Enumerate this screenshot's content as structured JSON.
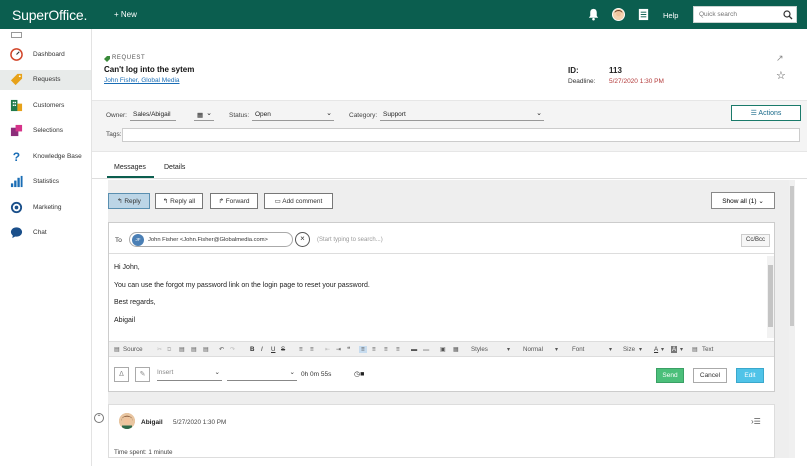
{
  "topbar": {
    "brand": "SuperOffice.",
    "new_label": "+ New",
    "help_label": "Help",
    "search_placeholder": "Quick search",
    "bg_color": "#0b5e4f"
  },
  "sidebar": {
    "items": [
      {
        "label": "Dashboard",
        "icon": "dashboard-gauge-icon"
      },
      {
        "label": "Requests",
        "icon": "requests-tag-icon"
      },
      {
        "label": "Customers",
        "icon": "customers-building-icon"
      },
      {
        "label": "Selections",
        "icon": "selections-icon"
      },
      {
        "label": "Knowledge Base",
        "icon": "question-mark-icon"
      },
      {
        "label": "Statistics",
        "icon": "bar-chart-icon"
      },
      {
        "label": "Marketing",
        "icon": "target-icon"
      },
      {
        "label": "Chat",
        "icon": "chat-bubble-icon"
      }
    ]
  },
  "request": {
    "type_label": "REQUEST",
    "title": "Can't log into the sytem",
    "contact": "John Fisher, Global Media",
    "id_label": "ID:",
    "id_value": "113",
    "deadline_label": "Deadline:",
    "deadline_value": "5/27/2020 1:30 PM"
  },
  "fields": {
    "owner_label": "Owner:",
    "owner_value": "Sales/Abigail",
    "status_label": "Status:",
    "status_value": "Open",
    "category_label": "Category:",
    "category_value": "Support",
    "tags_label": "Tags:",
    "actions_label": "☰ Actions"
  },
  "tabs": [
    {
      "label": "Messages",
      "active": true
    },
    {
      "label": "Details",
      "active": false
    }
  ],
  "thread_buttons": {
    "reply": "↰ Reply",
    "reply_all": "↰ Reply all",
    "forward": "↱ Forward",
    "add_comment": "▭ Add comment",
    "show_all": "Show all (1)"
  },
  "composer": {
    "to_label": "To",
    "recipient_initials": "JF",
    "recipient": "John Fisher <John.Fisher@Globalmedia.com>",
    "search_hint": "(Start typing to search...)",
    "ccbcc": "Cc/Bcc",
    "body_lines": [
      "Hi John,",
      "You can use the forgot my password link on the login page to reset your password.",
      "Best regards,",
      "Abigail"
    ],
    "toolbar": {
      "source": "Source",
      "bold": "B",
      "italic": "I",
      "underline": "U",
      "strike": "S",
      "styles": "Styles",
      "format": "Normal",
      "font": "Font",
      "size": "Size",
      "text_btn": "Text"
    },
    "insert_placeholder": "Insert",
    "time_spent": "0h 0m 55s",
    "send": "Send",
    "cancel": "Cancel",
    "edit": "Edit"
  },
  "message": {
    "author": "Abigail",
    "date": "5/27/2020 1:30 PM",
    "time_spent": "Time spent:  1 minute"
  }
}
